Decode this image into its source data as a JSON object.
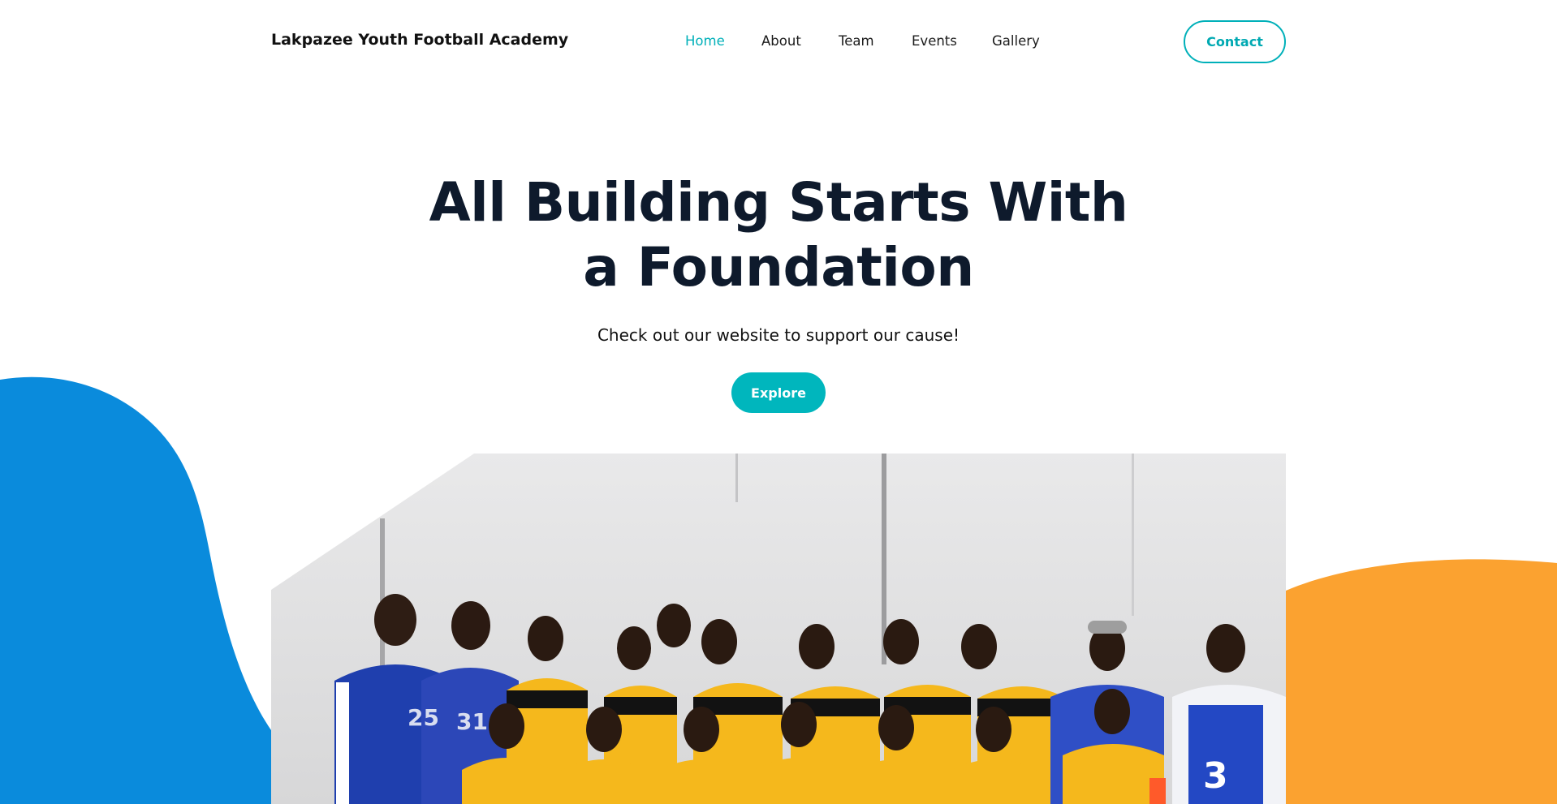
{
  "header": {
    "brand": "Lakpazee Youth Football Academy",
    "nav": [
      {
        "label": "Home",
        "active": true
      },
      {
        "label": "About",
        "active": false
      },
      {
        "label": "Team",
        "active": false
      },
      {
        "label": "Events",
        "active": false
      },
      {
        "label": "Gallery",
        "active": false
      }
    ],
    "contact_label": "Contact"
  },
  "hero": {
    "title_line1": "All Building Starts With",
    "title_line2": "a Foundation",
    "subtitle": "Check out our website to support our cause!",
    "explore_label": "Explore"
  },
  "photo": {
    "jersey_numbers": [
      "25",
      "31",
      "3"
    ]
  },
  "colors": {
    "accent": "#00b0b9",
    "blob_left": "#0a8bdc",
    "blob_right": "#fba230",
    "title": "#0e1a2c"
  }
}
